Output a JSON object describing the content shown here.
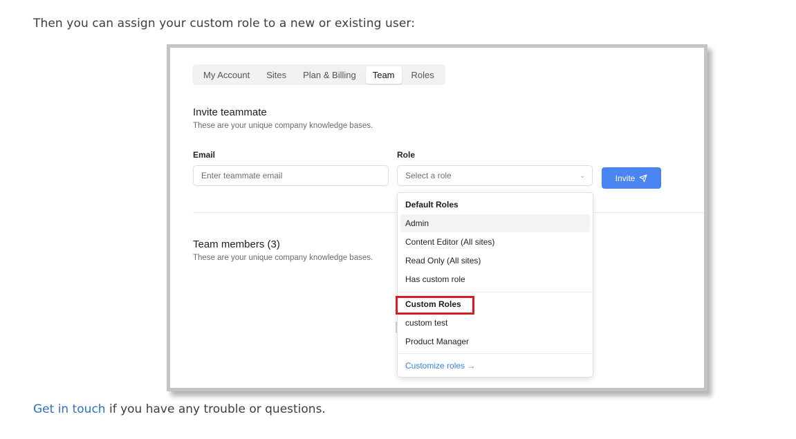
{
  "intro_text": "Then you can assign your custom role to a new or existing user:",
  "outro": {
    "link_text": "Get in touch",
    "rest_text": " if you have any trouble or questions."
  },
  "colors": {
    "accent": "#4a84f0",
    "link": "#2f6fbd",
    "highlight_border": "#d81b27"
  },
  "tabs": [
    {
      "label": "My Account",
      "active": false
    },
    {
      "label": "Sites",
      "active": false
    },
    {
      "label": "Plan & Billing",
      "active": false
    },
    {
      "label": "Team",
      "active": true
    },
    {
      "label": "Roles",
      "active": false
    }
  ],
  "invite": {
    "title": "Invite teammate",
    "subtitle": "These are your unique company knowledge bases.",
    "email_label": "Email",
    "email_placeholder": "Enter teammate email",
    "role_label": "Role",
    "role_placeholder": "Select a role",
    "button_label": "Invite",
    "button_icon": "send-icon"
  },
  "team": {
    "title": "Team members (3)",
    "subtitle": "These are your unique company knowledge bases."
  },
  "dropdown": {
    "default_header": "Default Roles",
    "default_roles": [
      "Admin",
      "Content Editor (All sites)",
      "Read Only (All sites)",
      "Has custom role"
    ],
    "custom_header": "Custom Roles",
    "custom_roles": [
      "custom test",
      "Product Manager"
    ],
    "footer_link": "Customize roles →",
    "hovered_item": "Admin"
  }
}
